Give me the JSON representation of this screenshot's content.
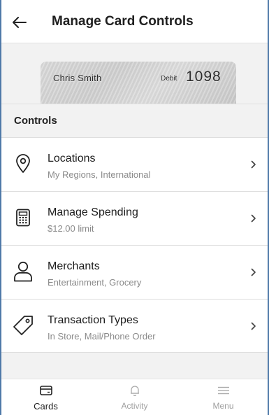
{
  "header": {
    "title": "Manage Card Controls",
    "back_icon": "arrow-left-icon"
  },
  "card": {
    "holder": "Chris Smith",
    "type": "Debit",
    "last_four": "1098"
  },
  "section": {
    "title": "Controls"
  },
  "controls": [
    {
      "icon": "location-pin-icon",
      "title": "Locations",
      "subtitle": "My Regions, International"
    },
    {
      "icon": "calculator-icon",
      "title": "Manage Spending",
      "subtitle": "$12.00 limit"
    },
    {
      "icon": "person-icon",
      "title": "Merchants",
      "subtitle": "Entertainment, Grocery"
    },
    {
      "icon": "tag-icon",
      "title": "Transaction Types",
      "subtitle": "In Store, Mail/Phone Order"
    }
  ],
  "nav": [
    {
      "icon": "card-icon",
      "label": "Cards",
      "active": true
    },
    {
      "icon": "bell-icon",
      "label": "Activity",
      "active": false
    },
    {
      "icon": "menu-icon",
      "label": "Menu",
      "active": false
    }
  ],
  "colors": {
    "frame_border": "#4f79a8",
    "background": "#f2f2f2",
    "active_nav": "#222222",
    "inactive_nav": "#9e9e9e"
  }
}
